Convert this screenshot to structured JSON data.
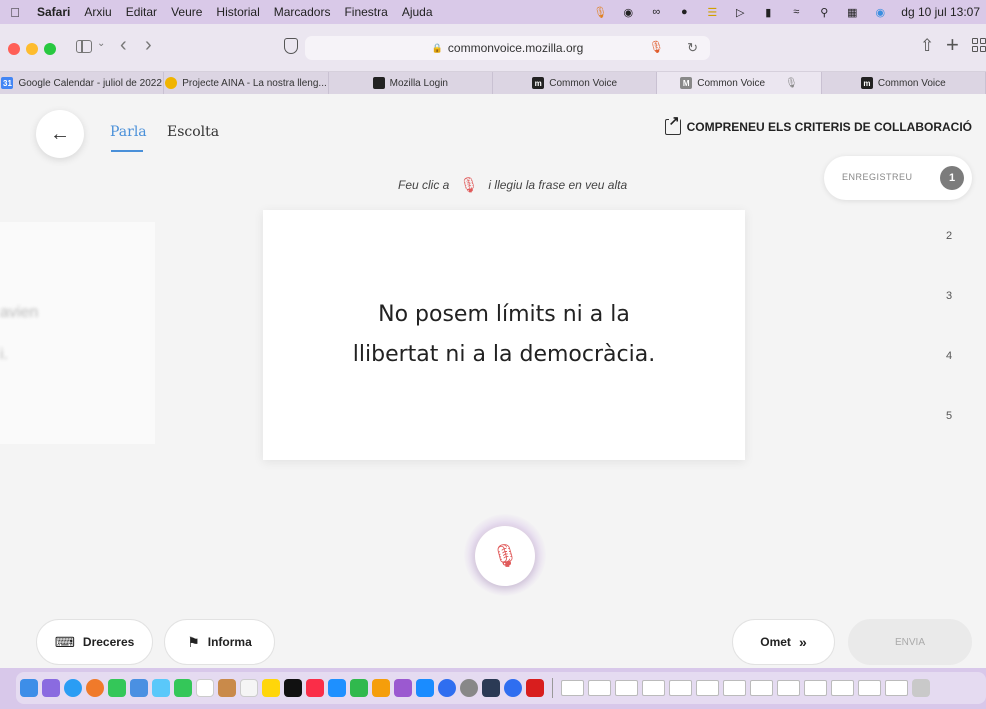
{
  "menubar": {
    "app": "Safari",
    "items": [
      "Arxiu",
      "Editar",
      "Veure",
      "Historial",
      "Marcadors",
      "Finestra",
      "Ajuda"
    ],
    "clock": "dg 10 jul  13:07"
  },
  "toolbar": {
    "url": "commonvoice.mozilla.org"
  },
  "tabs": [
    {
      "label": "Google Calendar - juliol de 2022",
      "fav": "31",
      "fav_color": "#4285f4"
    },
    {
      "label": "Projecte AINA - La nostra lleng...",
      "fav": "",
      "fav_color": "#f0b400"
    },
    {
      "label": "Mozilla Login",
      "fav": "",
      "fav_color": "#222222"
    },
    {
      "label": "Common Voice",
      "fav": "m",
      "fav_color": "#222222"
    },
    {
      "label": "Common Voice",
      "fav": "M",
      "fav_color": "#888888",
      "active": true
    },
    {
      "label": "Common Voice",
      "fav": "m",
      "fav_color": "#222222"
    }
  ],
  "page": {
    "tab_speak": "Parla",
    "tab_listen": "Escolta",
    "criteria_link": "COMPRENEU ELS CRITERIS DE COLLABORACIÓ",
    "instruction_before": "Feu clic a",
    "instruction_after": "i llegiu la frase en veu alta",
    "sentence_line_1": "No posem límits ni a la",
    "sentence_line_2": "llibertat ni a la democràcia.",
    "ghost_1": "avien",
    "ghost_2": "i.",
    "steps_label": "ENREGISTREU",
    "steps": [
      "1",
      "2",
      "3",
      "4",
      "5"
    ],
    "shortcuts": "Dreceres",
    "report": "Informa",
    "skip": "Omet",
    "send": "ENVIA"
  },
  "colors": {
    "accent": "#4a90d9",
    "mic": "#e05a5a",
    "menubar": "#d9c9e8"
  }
}
